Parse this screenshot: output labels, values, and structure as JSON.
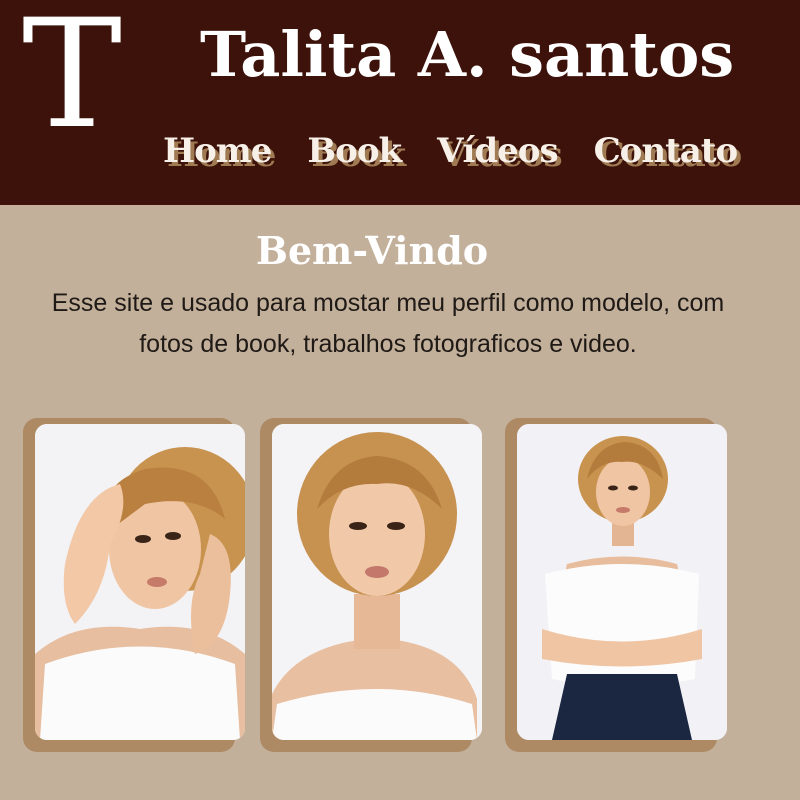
{
  "header": {
    "logo_letter": "T",
    "title": "Talita A. santos",
    "nav": [
      {
        "label": "Home"
      },
      {
        "label": "Book"
      },
      {
        "label": "Vídeos"
      },
      {
        "label": "Contato"
      }
    ]
  },
  "welcome": {
    "title": "Bem-Vindo",
    "text": "Esse site e usado para mostar meu perfil como modelo, com fotos de book, trabalhos fotograficos e video."
  },
  "colors": {
    "header_bg": "#3d120a",
    "page_bg": "#c3b09b",
    "card_back": "#ad8a63",
    "nav_shadow": "#a07a52"
  },
  "gallery": [
    {
      "icon": "model-photo-1"
    },
    {
      "icon": "model-photo-2"
    },
    {
      "icon": "model-photo-3"
    }
  ]
}
